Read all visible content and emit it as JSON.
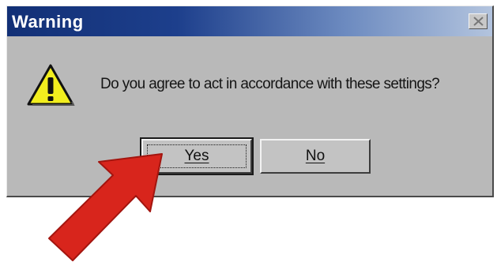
{
  "dialog": {
    "title": "Warning",
    "message": "Do you agree to act in accordance with these settings?",
    "buttons": {
      "yes_label": "Yes",
      "no_label": "No"
    },
    "icon": "warning-icon"
  },
  "colors": {
    "titlebar": "#123076",
    "dialog_body": "#b9b9b9",
    "warning_yellow": "#f2ee1e",
    "arrow_red": "#d8251c"
  }
}
